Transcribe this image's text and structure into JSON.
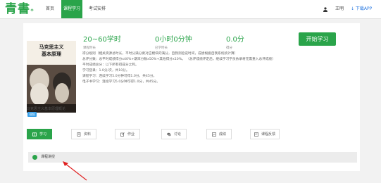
{
  "logo": "青書",
  "nav": {
    "home": "首页",
    "course_learning": "课程学习",
    "exam": "考试安排"
  },
  "user": {
    "name": "王明",
    "app_link": "↓ 下载APP"
  },
  "book": {
    "title_line1": "马克思主义",
    "title_line2": "基本原理",
    "caption": "马克思主义基本原理概论",
    "tag": "视频"
  },
  "stats": [
    {
      "value": "20~60学时",
      "label": "课程时长"
    },
    {
      "value": "0小时0分钟",
      "label": "已学时长"
    },
    {
      "value": "0.0分",
      "label": "得分"
    }
  ],
  "start_button": "开始学习",
  "description": [
    "得分规则（相关资源总时长，平时分满分要对应模块的满分，自我测验说时间，成绩根据自我系统统计算）",
    "总评分数：总平时成绩得分x40%+期末分数x50%+其他得分x10%。 （总评成绩评定后，继续学习学员依录将无需重入总评成绩）",
    "平时成绩总分：以下所有得成分之和。",
    "学习登录：1.0分/次，共10分。",
    "课程学习：连续学习5.0分钟可得1.0分，共45分。",
    "电子书学习：连续学习5.0分钟可得1.0分，共45分。"
  ],
  "tabs": [
    {
      "label": "学习",
      "icon": "book-icon",
      "active": true
    },
    {
      "label": "资料",
      "icon": "document-icon",
      "active": false
    },
    {
      "label": "作业",
      "icon": "edit-icon",
      "active": false
    },
    {
      "label": "讨论",
      "icon": "chat-icon",
      "active": false
    },
    {
      "label": "成绩",
      "icon": "chart-icon",
      "active": false
    },
    {
      "label": "课程反馈",
      "icon": "feedback-icon",
      "active": false
    }
  ],
  "section_title": "课程讲授",
  "colors": {
    "accent": "#2aa44a",
    "link": "#2a7ae2",
    "annotation_arrow": "#e02020"
  }
}
